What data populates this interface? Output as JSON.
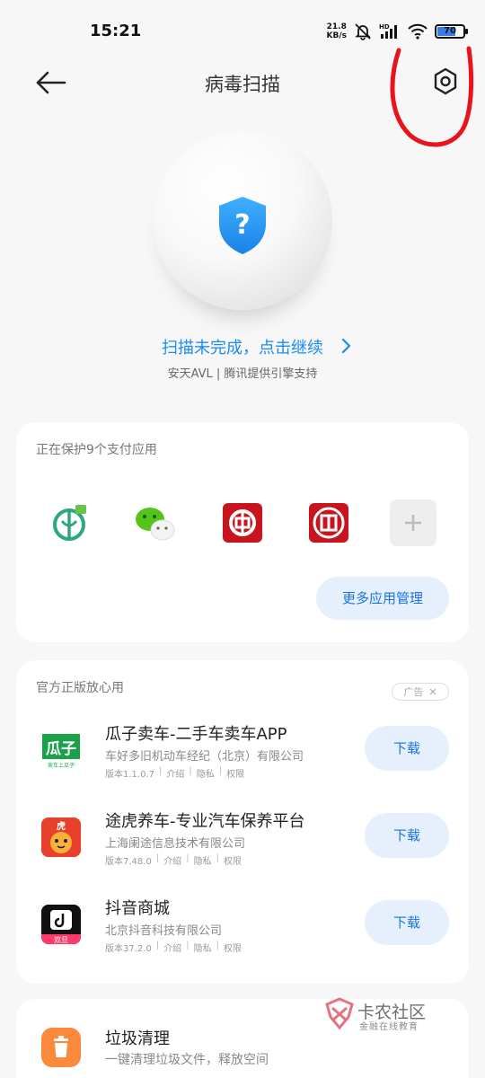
{
  "status_bar": {
    "time": "15:21",
    "speed_value": "21.8",
    "speed_unit": "KB/s",
    "hd": "HD",
    "battery": "70"
  },
  "header": {
    "title": "病毒扫描",
    "back_icon": "arrow-left-icon",
    "settings_icon": "hexagon-settings-icon"
  },
  "scan": {
    "status_text": "扫描未完成，点击继续",
    "engine_text": "安天AVL | 腾讯提供引擎支持",
    "shield_symbol": "?"
  },
  "payment": {
    "label": "正在保护9个支付应用",
    "apps": [
      "agricultural-bank-icon",
      "wechat-icon",
      "bank-of-china-icon",
      "icbc-icon",
      "add-app-icon"
    ],
    "more_button": "更多应用管理"
  },
  "recommend": {
    "label": "官方正版放心用",
    "ad_tag": "广告",
    "ad_close": "✕",
    "apps": [
      {
        "name": "瓜子卖车-二手车卖车APP",
        "company": "车好多旧机动车经纪（北京）有限公司",
        "version": "版本1.1.0.7",
        "intro": "介绍",
        "privacy": "隐私",
        "perm": "权限",
        "button": "下载",
        "icon_text": "瓜子",
        "icon_sub": "卖车上瓜子"
      },
      {
        "name": "途虎养车-专业汽车保养平台",
        "company": "上海阑途信息技术有限公司",
        "version": "版本7.48.0",
        "intro": "介绍",
        "privacy": "隐私",
        "perm": "权限",
        "button": "下载",
        "icon_text": "虎"
      },
      {
        "name": "抖音商城",
        "company": "北京抖音科技有限公司",
        "version": "版本37.2.0",
        "intro": "介绍",
        "privacy": "隐私",
        "perm": "权限",
        "button": "下载",
        "icon_text": "双旦"
      }
    ]
  },
  "cleaner": {
    "title": "垃圾清理",
    "subtitle": "一键清理垃圾文件，释放空间"
  },
  "watermark": {
    "title": "卡农社区",
    "subtitle": "金融在线教育"
  },
  "colors": {
    "accent": "#1a8cf0",
    "button_bg": "#e6f0fd",
    "annotation": "#e8141c"
  }
}
